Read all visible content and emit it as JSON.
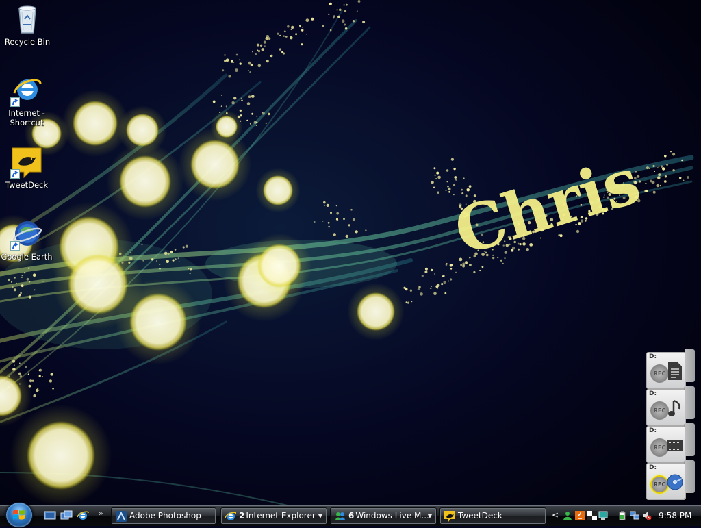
{
  "desktop": {
    "wallpaper_text": "Chris",
    "icons": [
      {
        "label": "Recycle Bin",
        "icon": "recycle-bin-icon"
      },
      {
        "label": "Internet -\nShortcut",
        "icon": "internet-explorer-icon"
      },
      {
        "label": "TweetDeck",
        "icon": "tweetdeck-icon"
      },
      {
        "label": "Google Earth",
        "icon": "google-earth-icon"
      }
    ]
  },
  "gadget": {
    "cubes": [
      {
        "drive": "D:",
        "rec": "REC",
        "glyph": "document-icon"
      },
      {
        "drive": "D:",
        "rec": "REC",
        "glyph": "music-note-icon"
      },
      {
        "drive": "D:",
        "rec": "REC",
        "glyph": "film-strip-icon"
      },
      {
        "drive": "D:",
        "rec": "REC",
        "glyph": "disc-icon"
      }
    ]
  },
  "taskbar": {
    "quick_launch": [
      "show-desktop-icon",
      "switch-windows-icon",
      "internet-explorer-icon"
    ],
    "quick_launch_more": "»",
    "tasks": [
      {
        "label": "Adobe Photoshop",
        "count": "",
        "icon": "photoshop-icon",
        "dropdown": false
      },
      {
        "label": "Internet Explorer",
        "count": "2",
        "icon": "internet-explorer-icon",
        "dropdown": true
      },
      {
        "label": "Windows Live M...",
        "count": "6",
        "icon": "windows-live-messenger-icon",
        "dropdown": true
      },
      {
        "label": "TweetDeck",
        "count": "",
        "icon": "tweetdeck-icon",
        "dropdown": false
      }
    ],
    "tray": {
      "expand": "<",
      "icons": [
        "messenger-status-icon",
        "java-icon",
        "display-icon",
        "network-icon",
        "battery-icon",
        "network-connection-icon",
        "volume-muted-icon"
      ],
      "clock": "9:58 PM"
    }
  },
  "colors": {
    "background": "#04051e",
    "glow_yellow": "#f2ee8c",
    "swirl_green": "#6ee0b0",
    "name_text": "#f4f08a"
  }
}
